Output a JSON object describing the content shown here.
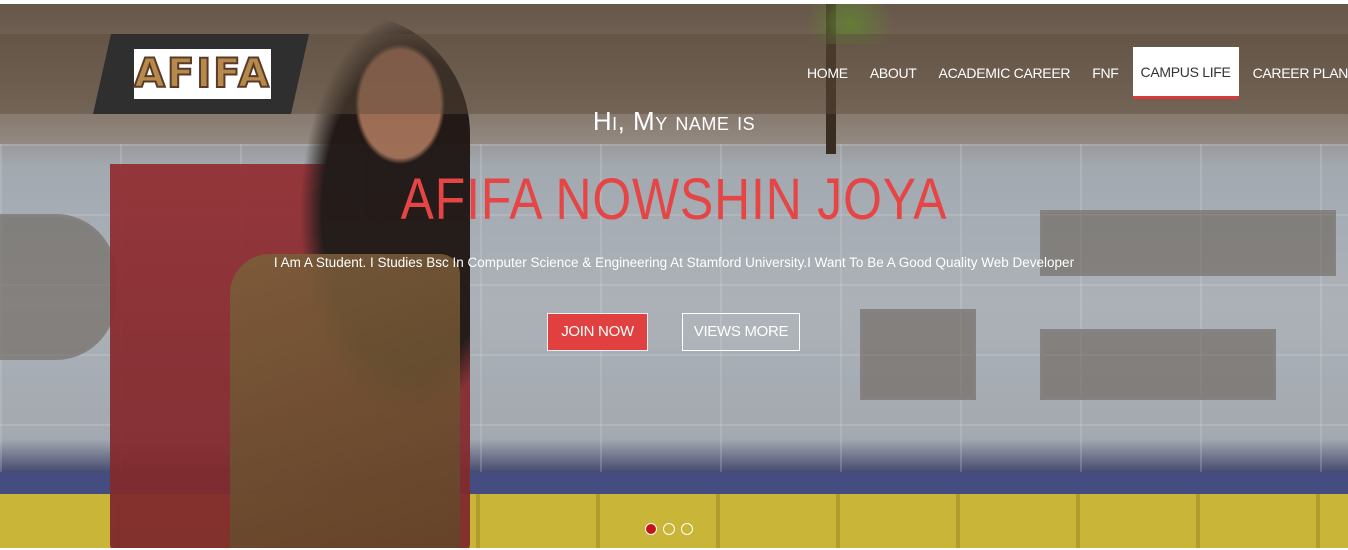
{
  "logo": {
    "text": "AFIFA"
  },
  "nav": {
    "items": [
      {
        "label": "HOME"
      },
      {
        "label": "ABOUT"
      },
      {
        "label": "ACADEMIC CAREER"
      },
      {
        "label": "FNF"
      },
      {
        "label": "CAMPUS LIFE",
        "active": true
      },
      {
        "label": "CAREER PLAN"
      }
    ]
  },
  "hero": {
    "greeting": "Hi, My name is",
    "name": "AFIFA NOWSHIN JOYA",
    "tagline": "I Am A Student. I Studies Bsc In Computer Science & Engineering At Stamford University.I Want To Be A Good Quality Web Developer",
    "join_label": "JOIN NOW",
    "views_label": "VIEWS MORE",
    "slides": {
      "count": 3,
      "active": 1
    }
  },
  "colors": {
    "accent": "#e04040",
    "name_color": "#e54545",
    "active_dot": "#c4141a"
  }
}
